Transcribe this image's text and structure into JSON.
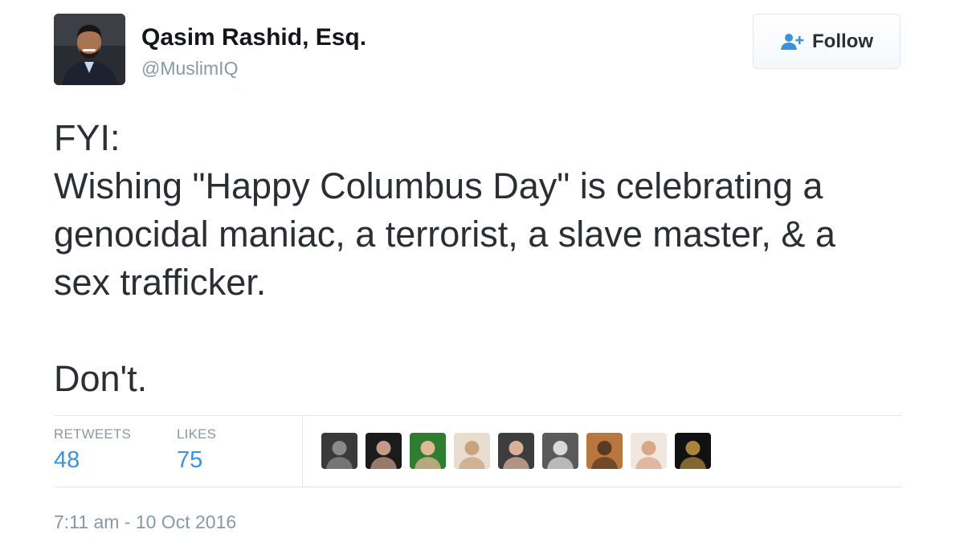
{
  "author": {
    "display_name": "Qasim Rashid, Esq.",
    "handle": "@MuslimIQ"
  },
  "follow_button": {
    "label": "Follow",
    "icon": "add-user-icon"
  },
  "tweet": {
    "lines": [
      "FYI:",
      "Wishing \"Happy Columbus Day\" is celebrating a",
      "genocidal maniac, a terrorist, a slave master, & a",
      "sex trafficker.",
      "",
      "Don't."
    ]
  },
  "stats": {
    "retweets_label": "RETWEETS",
    "retweets_count": "48",
    "likes_label": "LIKES",
    "likes_count": "75"
  },
  "likers": [
    {
      "name": "liker-1",
      "bg": "#3a3a3a",
      "fg": "#8a8a8a"
    },
    {
      "name": "liker-2",
      "bg": "#1b1b1b",
      "fg": "#c49a86"
    },
    {
      "name": "liker-3",
      "bg": "#2f7d32",
      "fg": "#e0b896"
    },
    {
      "name": "liker-4",
      "bg": "#e9ddd0",
      "fg": "#c8a37e"
    },
    {
      "name": "liker-5",
      "bg": "#3d3d3d",
      "fg": "#d8b19a"
    },
    {
      "name": "liker-6",
      "bg": "#5a5a5a",
      "fg": "#d9d9d9"
    },
    {
      "name": "liker-7",
      "bg": "#b9773f",
      "fg": "#5a3a22"
    },
    {
      "name": "liker-8",
      "bg": "#f2e7df",
      "fg": "#d9a88b"
    },
    {
      "name": "liker-9",
      "bg": "#111111",
      "fg": "#a8843c"
    }
  ],
  "timestamp": "7:11 am - 10 Oct 2016",
  "colors": {
    "link_blue": "#3b94d9",
    "muted_gray": "#8899a6",
    "text_dark": "#292f33",
    "border": "#e1e8ed"
  }
}
